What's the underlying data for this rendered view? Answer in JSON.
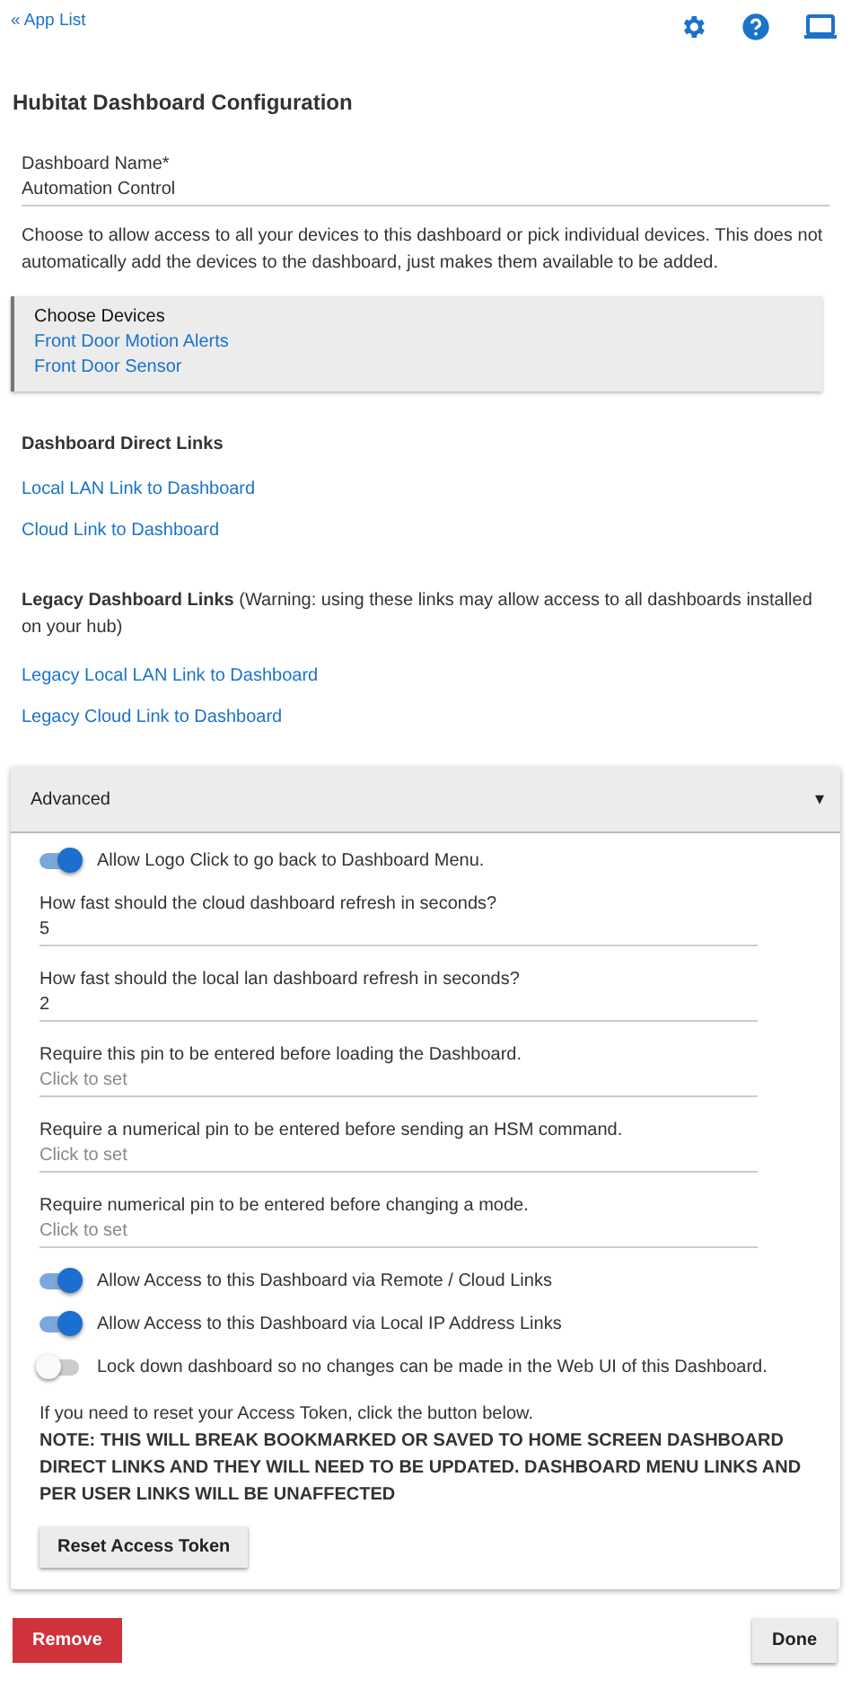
{
  "top_bar": {
    "back_link": "« App List"
  },
  "title": "Hubitat Dashboard Configuration",
  "name_field": {
    "label": "Dashboard Name*",
    "value": "Automation Control"
  },
  "devices_note": "Choose to allow access to all your devices to this dashboard or pick individual devices. This does not automatically add the devices to the dashboard, just makes them available to be added.",
  "devices_picker": {
    "label": "Choose Devices",
    "selected": [
      "Front Door Motion Alerts",
      "Front Door Sensor"
    ]
  },
  "direct_links": {
    "heading": "Dashboard Direct Links",
    "links": [
      "Local LAN Link to Dashboard",
      "Cloud Link to Dashboard"
    ]
  },
  "legacy_links": {
    "heading": "**Legacy Dashboard Links** (Warning: using these links may allow access to all dashboards installed on your hub)",
    "links": [
      "Legacy Local LAN Link to Dashboard",
      "Legacy Cloud Link to Dashboard"
    ]
  },
  "advanced": {
    "title": "Advanced",
    "caret": "▾",
    "expanded": true,
    "items": [
      {
        "kind": "toggle",
        "label": "Allow Logo Click to go back to Dashboard Menu.",
        "on": true
      },
      {
        "kind": "field",
        "label": "How fast should the cloud dashboard refresh in seconds?",
        "value": "5"
      },
      {
        "kind": "field",
        "label": "How fast should the local lan dashboard refresh in seconds?",
        "value": "2"
      },
      {
        "kind": "field",
        "label": "Require this pin to be entered before loading the Dashboard.",
        "placeholder": "Click to set"
      },
      {
        "kind": "field",
        "label": "Require a numerical pin to be entered before sending an HSM command.",
        "placeholder": "Click to set"
      },
      {
        "kind": "field",
        "label": "Require numerical pin to be entered before changing a mode.",
        "placeholder": "Click to set"
      },
      {
        "kind": "toggle",
        "label": "Allow Access to this Dashboard via Remote / Cloud Links",
        "on": true
      },
      {
        "kind": "toggle",
        "label": "Allow Access to this Dashboard via Local IP Address Links",
        "on": true
      },
      {
        "kind": "toggle",
        "label": "Lock down dashboard so no changes can be made in the Web UI of this Dashboard.",
        "on": false
      },
      {
        "kind": "text",
        "text": "If you need to reset your Access Token, click the button below."
      },
      {
        "kind": "warning",
        "text": "NOTE: THIS WILL BREAK BOOKMARKED OR SAVED TO HOME SCREEN DASHBOARD DIRECT LINKS AND THEY WILL NEED TO BE UPDATED. DASHBOARD MENU LINKS AND PER USER LINKS WILL BE UNAFFECTED"
      },
      {
        "kind": "button",
        "label": "Reset Access Token"
      }
    ]
  },
  "footer": {
    "remove": "Remove",
    "done": "Done"
  }
}
